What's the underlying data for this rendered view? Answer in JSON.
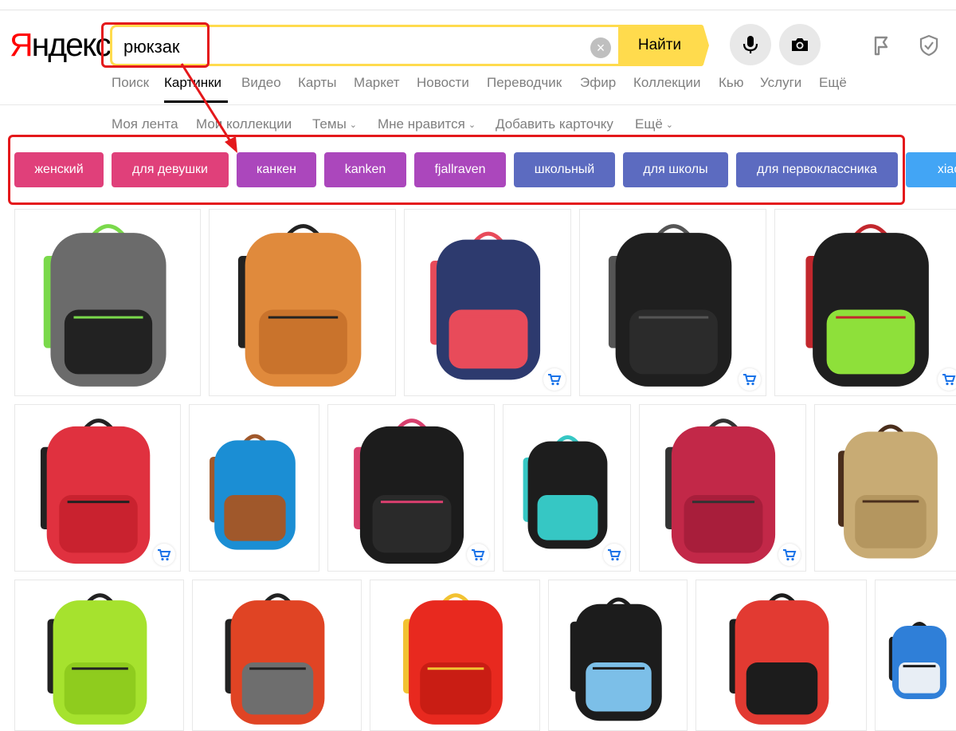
{
  "logo": {
    "first_letter": "Я",
    "rest": "ндекс"
  },
  "search": {
    "query": "рюкзак",
    "clear_label": "×",
    "submit_label": "Найти"
  },
  "services": [
    {
      "label": "Поиск",
      "active": false
    },
    {
      "label": "Картинки",
      "active": true
    },
    {
      "label": "Видео",
      "active": false
    },
    {
      "label": "Карты",
      "active": false
    },
    {
      "label": "Маркет",
      "active": false
    },
    {
      "label": "Новости",
      "active": false
    },
    {
      "label": "Переводчик",
      "active": false
    },
    {
      "label": "Эфир",
      "active": false
    },
    {
      "label": "Коллекции",
      "active": false
    },
    {
      "label": "Кью",
      "active": false
    },
    {
      "label": "Услуги",
      "active": false
    },
    {
      "label": "Ещё",
      "active": false
    }
  ],
  "subnav": [
    {
      "label": "Моя лента",
      "dropdown": false
    },
    {
      "label": "Мои коллекции",
      "dropdown": false
    },
    {
      "label": "Темы",
      "dropdown": true
    },
    {
      "label": "Мне нравится",
      "dropdown": true
    },
    {
      "label": "Добавить карточку",
      "dropdown": false
    },
    {
      "label": "Ещё",
      "dropdown": true
    }
  ],
  "tags": [
    {
      "label": "женский",
      "color": "#e0407a"
    },
    {
      "label": "для девушки",
      "color": "#e0407a"
    },
    {
      "label": "канкен",
      "color": "#ab47bc"
    },
    {
      "label": "kanken",
      "color": "#ab47bc"
    },
    {
      "label": "fjallraven",
      "color": "#ab47bc"
    },
    {
      "label": "школьный",
      "color": "#5c6bc0"
    },
    {
      "label": "для школы",
      "color": "#5c6bc0"
    },
    {
      "label": "для первоклассника",
      "color": "#5c6bc0"
    },
    {
      "label": "xiaomi",
      "color": "#42a5f5"
    }
  ],
  "icons": {
    "mic": "microphone-icon",
    "camera": "camera-icon",
    "collections": "collections-icon",
    "shield": "shield-icon",
    "cart": "cart-icon"
  },
  "colors": {
    "search_border": "#ffdb4d",
    "submit_bg": "#ffdb4d",
    "annotation": "#e4181b",
    "cart": "#1a73e8"
  },
  "images": [
    {
      "desc": "grey melange backpack with green zipper",
      "body": "#6b6b6b",
      "accent": "#222222",
      "trim": "#7ad94b",
      "cart": false
    },
    {
      "desc": "orange backpack",
      "body": "#e08a3c",
      "accent": "#c9732c",
      "trim": "#222222",
      "cart": false
    },
    {
      "desc": "navy backpack with red pixel front",
      "body": "#2d3a6e",
      "accent": "#e84b5a",
      "trim": "#e84b5a",
      "cart": true
    },
    {
      "desc": "black laptop backpack",
      "body": "#1f1f1f",
      "accent": "#2b2b2b",
      "trim": "#555555",
      "cart": true
    },
    {
      "desc": "black backpack with lime front",
      "body": "#1f1f1f",
      "accent": "#8ee03a",
      "trim": "#c2272d",
      "cart": true
    },
    {
      "desc": "red backpack",
      "body": "#e0313f",
      "accent": "#c9222f",
      "trim": "#222222",
      "cart": true
    },
    {
      "desc": "blue backpack with brown bottom",
      "body": "#1b8ed4",
      "accent": "#a0582b",
      "trim": "#a0582b",
      "cart": false
    },
    {
      "desc": "black backpack with pink trim",
      "body": "#1c1c1c",
      "accent": "#2a2a2a",
      "trim": "#d83f6e",
      "cart": true
    },
    {
      "desc": "black backpack with teal sides",
      "body": "#1d1d1d",
      "accent": "#36c7c4",
      "trim": "#36c7c4",
      "cart": true
    },
    {
      "desc": "crimson backpack",
      "body": "#c22848",
      "accent": "#a81e3b",
      "trim": "#333333",
      "cart": true
    },
    {
      "desc": "khaki canvas backpack",
      "body": "#c8ab74",
      "accent": "#b4965f",
      "trim": "#4a2e1c",
      "cart": false
    },
    {
      "desc": "lime green backpack",
      "body": "#a6e22e",
      "accent": "#8fcc1e",
      "trim": "#222222",
      "cart": false
    },
    {
      "desc": "red and grey hiking backpack",
      "body": "#e04424",
      "accent": "#6e6e6e",
      "trim": "#222222",
      "cart": false
    },
    {
      "desc": "red hiking backpack",
      "body": "#e8291f",
      "accent": "#c91d14",
      "trim": "#f2c232",
      "cart": false
    },
    {
      "desc": "black and light blue backpack",
      "body": "#1c1c1c",
      "accent": "#7cbfe8",
      "trim": "#1c1c1c",
      "cart": false
    },
    {
      "desc": "red and black backpack",
      "body": "#e23a32",
      "accent": "#1c1c1c",
      "trim": "#1c1c1c",
      "cart": false
    },
    {
      "desc": "blue and white backpack",
      "body": "#2f7fd8",
      "accent": "#e8eef5",
      "trim": "#1c1c1c",
      "cart": false
    }
  ]
}
